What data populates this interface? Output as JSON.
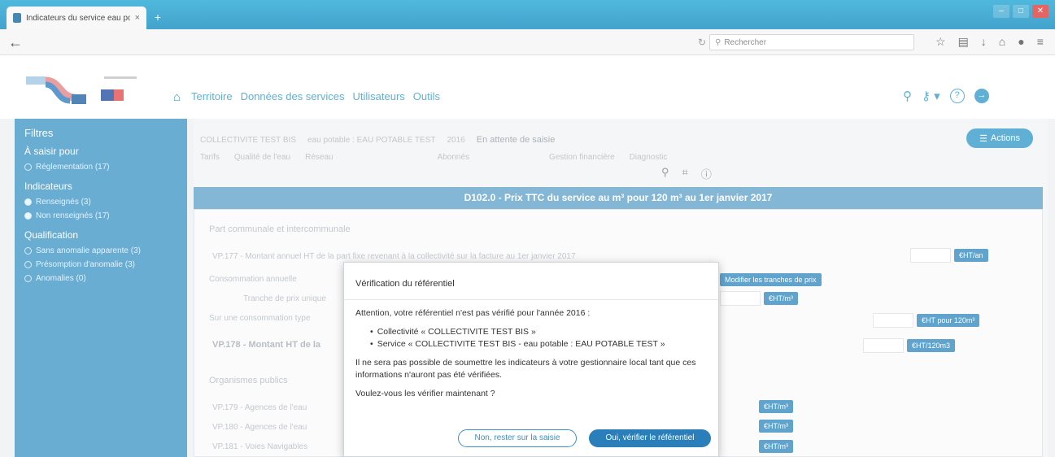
{
  "browser": {
    "tab_title": "Indicateurs du service eau pota...",
    "tab_close": "×",
    "new_tab": "+",
    "search_placeholder": "Rechercher"
  },
  "header": {
    "nav": [
      "Territoire",
      "Données des services",
      "Utilisateurs",
      "Outils"
    ]
  },
  "sidebar": {
    "title": "Filtres",
    "sections": [
      {
        "label": "À saisir pour",
        "items": [
          {
            "label": "Réglementation (17)",
            "on": false
          }
        ]
      },
      {
        "label": "Indicateurs",
        "items": [
          {
            "label": "Renseignés (3)",
            "on": true
          },
          {
            "label": "Non renseignés (17)",
            "on": true
          }
        ]
      },
      {
        "label": "Qualification",
        "items": [
          {
            "label": "Sans anomalie apparente (3)",
            "on": false
          },
          {
            "label": "Présomption d'anomalie (3)",
            "on": false
          },
          {
            "label": "Anomalies (0)",
            "on": false
          }
        ]
      }
    ]
  },
  "filters": {
    "collectivite": "COLLECTIVITE TEST BIS",
    "service": "eau potable : EAU POTABLE TEST",
    "year": "2016",
    "status": "En attente de saisie",
    "tabs": [
      "Tarifs",
      "Qualité de l'eau",
      "Réseau",
      "Abonnés",
      "Gestion financière",
      "Diagnostic"
    ]
  },
  "actions": {
    "label": "Actions"
  },
  "panel": {
    "title": "D102.0 - Prix TTC du service au m³ pour 120 m³ au 1er janvier 2017",
    "section1": "Part communale et intercommunale",
    "row1": "VP.177 - Montant annuel HT de la part fixe revenant à la collectivité sur la facture au 1er janvier 2017",
    "row1_unit": "€HT/an",
    "row2": "Consommation annuelle",
    "row2_btn": "Modifier les tranches de prix",
    "row3": "Tranche de prix unique",
    "row3_unit": "€HT/m³",
    "row4": "Sur une consommation type",
    "row4_unit": "€HT pour 120m³",
    "row5": "VP.178 - Montant HT de la",
    "row5_unit": "€HT/120m3",
    "section2": "Organismes publics",
    "row6": "VP.179 - Agences de l'eau",
    "row7": "VP.180 - Agences de l'eau",
    "row8": "VP.181 - Voies Navigables",
    "row_unit": "€HT/m³"
  },
  "modal": {
    "title": "Vérification du référentiel",
    "intro": "Attention, votre référentiel n'est pas vérifié pour l'année 2016 :",
    "items": [
      "Collectivité « COLLECTIVITE TEST BIS »",
      "Service « COLLECTIVITE TEST BIS - eau potable : EAU POTABLE TEST »"
    ],
    "warning": "Il ne sera pas possible de soumettre les indicateurs à votre gestionnaire local tant que ces informations n'auront pas été vérifiées.",
    "question": "Voulez-vous les vérifier maintenant ?",
    "btn_no": "Non, rester sur la saisie",
    "btn_yes": "Oui, vérifier le référentiel"
  }
}
